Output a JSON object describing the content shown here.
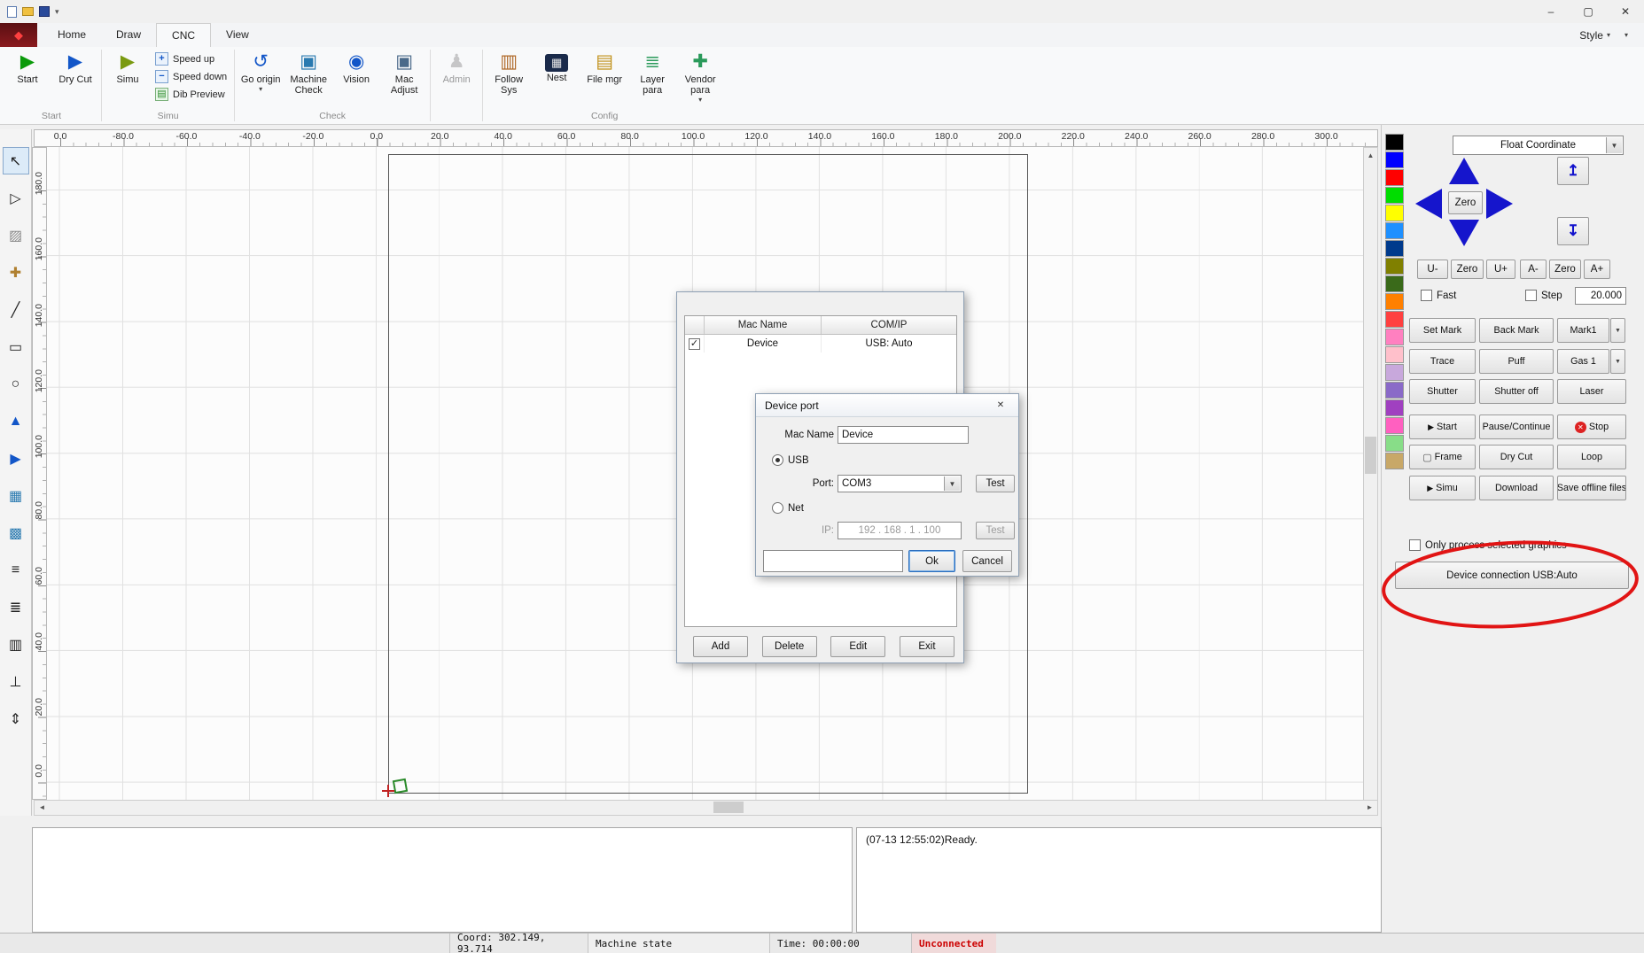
{
  "icons": {
    "app_logo": "◆",
    "minimize": "–",
    "maximize": "▢",
    "close": "✕",
    "dropdown": "▾",
    "combo_arrow": "▼",
    "check": "✓",
    "scroll_up": "▲",
    "scroll_down": "▼",
    "scroll_left": "◄",
    "scroll_right": "►",
    "dialog_close": "✕",
    "play": "▶",
    "stop_x": "✕",
    "frame": "▢",
    "z_up": "↥",
    "z_down": "↧"
  },
  "ribbon_icons": {
    "start": "▶",
    "dry_cut": "▶",
    "simu": "▶",
    "speed_up": "+",
    "speed_down": "−",
    "dib_preview": "▤",
    "go_origin": "↺",
    "machine_check": "▣",
    "vision": "◉",
    "mac_adjust": "▣",
    "admin": "♟",
    "follow_sys": "▥",
    "nest": "▦",
    "file_mgr": "▤",
    "layer_para": "≣",
    "vendor_para": "✚"
  },
  "tabs": [
    "Home",
    "Draw",
    "CNC",
    "View"
  ],
  "active_tab": "CNC",
  "style_menu": "Style",
  "ribbon": {
    "start": "Start",
    "dry_cut": "Dry Cut",
    "simu": "Simu",
    "speed_up": "Speed up",
    "speed_down": "Speed down",
    "dib_preview": "Dib Preview",
    "go_origin": "Go origin",
    "machine_check": "Machine Check",
    "vision": "Vision",
    "mac_adjust": "Mac Adjust",
    "admin": "Admin",
    "follow_sys": "Follow Sys",
    "nest": "Nest",
    "file_mgr": "File mgr",
    "layer_para": "Layer para",
    "vendor_para": "Vendor para",
    "groups": {
      "start": "Start",
      "simu": "Simu",
      "check": "Check",
      "config": "Config"
    }
  },
  "rulers": {
    "horizontal": [
      "0.0",
      "-80.0",
      "-60.0",
      "-40.0",
      "-20.0",
      "0.0",
      "20.0",
      "40.0",
      "60.0",
      "80.0",
      "100.0",
      "120.0",
      "140.0",
      "160.0",
      "180.0",
      "200.0",
      "220.0",
      "240.0",
      "260.0",
      "280.0",
      "300.0"
    ],
    "vertical": [
      "180.0",
      "160.0",
      "140.0",
      "120.0",
      "100.0",
      "80.0",
      "60.0",
      "40.0",
      "20.0",
      "0.0"
    ]
  },
  "left_toolbar": [
    {
      "name": "select-tool",
      "glyph": "↖",
      "color": "#222222"
    },
    {
      "name": "node-edit-tool",
      "glyph": "▷",
      "color": "#222222"
    },
    {
      "name": "fill-tool",
      "glyph": "▨",
      "color": "#888888"
    },
    {
      "name": "pan-tool",
      "glyph": "✚",
      "color": "#b08030"
    },
    {
      "name": "line-tool",
      "glyph": "╱",
      "color": "#222222"
    },
    {
      "name": "rectangle-tool",
      "glyph": "▭",
      "color": "#222222"
    },
    {
      "name": "ellipse-tool",
      "glyph": "○",
      "color": "#222222"
    },
    {
      "name": "mirror-tool",
      "glyph": "▲",
      "color": "#1256c8"
    },
    {
      "name": "direction-tool",
      "glyph": "▶",
      "color": "#1256c8"
    },
    {
      "name": "array-tool",
      "glyph": "▦",
      "color": "#2a7ab0"
    },
    {
      "name": "hatch-tool",
      "glyph": "▩",
      "color": "#2a7ab0"
    },
    {
      "name": "align-left-tool",
      "glyph": "≡",
      "color": "#222222"
    },
    {
      "name": "align-center-tool",
      "glyph": "≣",
      "color": "#222222"
    },
    {
      "name": "distribute-tool",
      "glyph": "▥",
      "color": "#222222"
    },
    {
      "name": "baseline-tool",
      "glyph": "⊥",
      "color": "#222222"
    },
    {
      "name": "order-tool",
      "glyph": "⇕",
      "color": "#222222"
    }
  ],
  "palette": [
    "#000000",
    "#0000ff",
    "#ff0000",
    "#00dd00",
    "#ffff00",
    "#1e90ff",
    "#003a8c",
    "#808000",
    "#3a6a1a",
    "#ff8000",
    "#ff4040",
    "#ff80c0",
    "#ffc0cb",
    "#c8a8dc",
    "#8a6ac8",
    "#a040c0",
    "#ff60c0",
    "#88dd88",
    "#c8a868"
  ],
  "right_panel": {
    "coord_mode": "Float Coordinate",
    "zero_center": "Zero",
    "jog_buttons": [
      "U-",
      "Zero",
      "U+",
      "A-",
      "Zero",
      "A+"
    ],
    "fast_label": "Fast",
    "step_label": "Step",
    "step_value": "20.000",
    "button_rows": [
      [
        {
          "label": "Set Mark"
        },
        {
          "label": "Back Mark"
        },
        {
          "label": "Mark1",
          "arrow": true
        }
      ],
      [
        {
          "label": "Trace"
        },
        {
          "label": "Puff"
        },
        {
          "label": "Gas 1",
          "arrow": true
        }
      ],
      [
        {
          "label": "Shutter"
        },
        {
          "label": "Shutter off"
        },
        {
          "label": "Laser"
        }
      ],
      [
        {
          "label": "Start",
          "icon": "play"
        },
        {
          "label": "Pause/Continue"
        },
        {
          "label": "Stop",
          "icon": "stop"
        }
      ],
      [
        {
          "label": "Frame",
          "icon": "frame"
        },
        {
          "label": "Dry Cut"
        },
        {
          "label": "Loop"
        }
      ],
      [
        {
          "label": "Simu",
          "icon": "play"
        },
        {
          "label": "Download"
        },
        {
          "label": "Save offline files"
        }
      ]
    ],
    "only_selected": "Only process selected graphics",
    "device_connection": "Device connection USB:Auto"
  },
  "device_list_dialog": {
    "columns": [
      "Mac Name",
      "COM/IP"
    ],
    "row": {
      "checked": true,
      "mac_name": "Device",
      "com_ip": "USB: Auto"
    },
    "buttons": [
      "Add",
      "Delete",
      "Edit",
      "Exit"
    ]
  },
  "device_port_dialog": {
    "title": "Device port",
    "mac_name_label": "Mac Name",
    "mac_name_value": "Device",
    "usb_label": "USB",
    "port_label": "Port:",
    "port_value": "COM3",
    "test_label": "Test",
    "net_label": "Net",
    "ip_label": "IP:",
    "ip_value": "192 . 168 . 1 . 100",
    "ok": "Ok",
    "cancel": "Cancel"
  },
  "log": "(07-13 12:55:02)Ready.",
  "status_bar": {
    "coord": "Coord: 302.149, 93.714",
    "machine_state": "Machine state",
    "time": "Time: 00:00:00",
    "connection": "Unconnected"
  },
  "annotation_color": "#e11414"
}
